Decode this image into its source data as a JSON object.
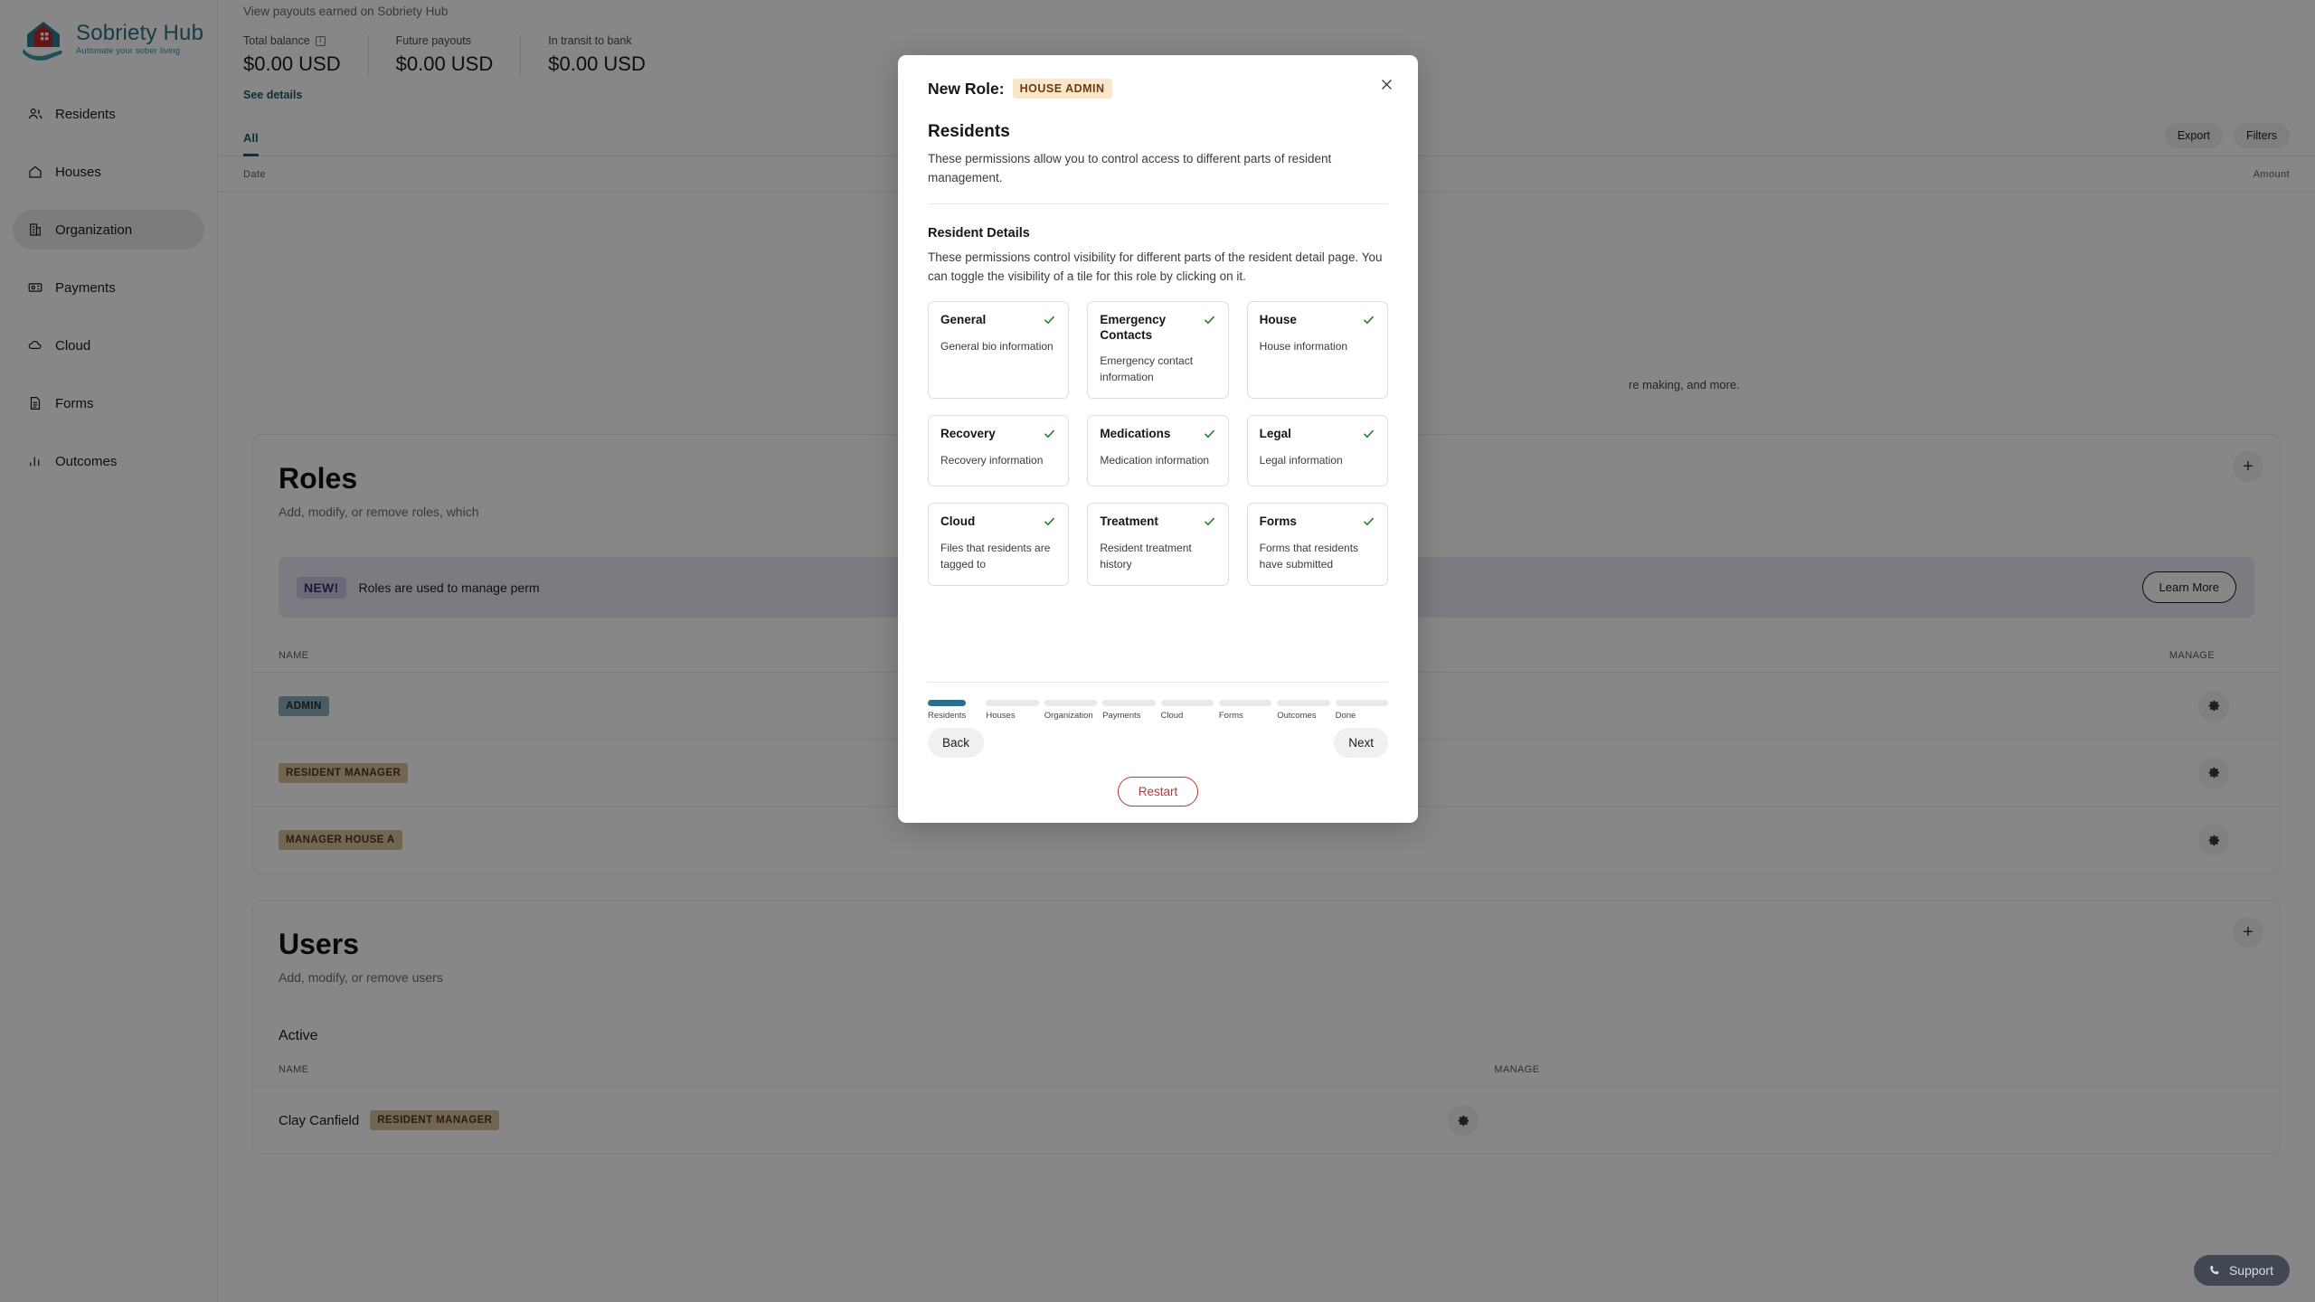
{
  "brand": {
    "name": "Sobriety Hub",
    "tagline": "Automate your sober living"
  },
  "sidebar": {
    "items": [
      {
        "label": "Residents",
        "icon": "users-icon",
        "active": false
      },
      {
        "label": "Houses",
        "icon": "home-icon",
        "active": false
      },
      {
        "label": "Organization",
        "icon": "building-icon",
        "active": true
      },
      {
        "label": "Payments",
        "icon": "card-icon",
        "active": false
      },
      {
        "label": "Cloud",
        "icon": "cloud-icon",
        "active": false
      },
      {
        "label": "Forms",
        "icon": "document-icon",
        "active": false
      },
      {
        "label": "Outcomes",
        "icon": "bar-chart-icon",
        "active": false
      }
    ]
  },
  "payouts": {
    "subtitle": "View payouts earned on Sobriety Hub",
    "stats": [
      {
        "label": "Total balance",
        "value": "$0.00 USD",
        "has_info_icon": true
      },
      {
        "label": "Future payouts",
        "value": "$0.00 USD",
        "has_info_icon": false
      },
      {
        "label": "In transit to bank",
        "value": "$0.00 USD",
        "has_info_icon": false
      }
    ],
    "see_details": "See details",
    "tab": "All",
    "export_label": "Export",
    "filters_label": "Filters",
    "col_date": "Date",
    "col_amount": "Amount",
    "empty_note": "re making, and more."
  },
  "roles_section": {
    "title": "Roles",
    "subtitle": "Add, modify, or remove roles, which",
    "add_label": "+",
    "banner": {
      "chip": "NEW!",
      "text": "Roles are used to manage perm",
      "button": "Learn More"
    },
    "columns": {
      "name": "NAME",
      "manage": "MANAGE"
    },
    "rows": [
      {
        "name": "ADMIN",
        "bg": "#8fb0bd",
        "fg": "#1d2f36"
      },
      {
        "name": "RESIDENT MANAGER",
        "bg": "#d7bf9c",
        "fg": "#4a3a22"
      },
      {
        "name": "MANAGER HOUSE A",
        "bg": "#d7bf9c",
        "fg": "#4a3a22"
      }
    ]
  },
  "users_section": {
    "title": "Users",
    "subtitle": "Add, modify, or remove users",
    "add_label": "+",
    "active_label": "Active",
    "columns": {
      "name": "NAME",
      "manage": "MANAGE"
    },
    "rows": [
      {
        "name": "Clay Canfield",
        "role": "RESIDENT MANAGER",
        "bg": "#d7bf9c",
        "fg": "#4a3a22"
      }
    ]
  },
  "support": {
    "label": "Support",
    "icon": "phone-icon"
  },
  "modal": {
    "role_label": "New Role:",
    "role_badge": "HOUSE ADMIN",
    "close_icon": "close-icon",
    "section_title": "Residents",
    "section_desc": "These permissions allow you to control access to different parts of resident management.",
    "sub_title": "Resident Details",
    "sub_desc": "These permissions control visibility for different parts of the resident detail page. You can toggle the visibility of a tile for this role by clicking on it.",
    "tiles": [
      {
        "name": "General",
        "desc": "General bio information",
        "enabled": true
      },
      {
        "name": "Emergency Contacts",
        "desc": "Emergency contact information",
        "enabled": true
      },
      {
        "name": "House",
        "desc": "House information",
        "enabled": true
      },
      {
        "name": "Recovery",
        "desc": "Recovery information",
        "enabled": true
      },
      {
        "name": "Medications",
        "desc": "Medication information",
        "enabled": true
      },
      {
        "name": "Legal",
        "desc": "Legal information",
        "enabled": true
      },
      {
        "name": "Cloud",
        "desc": "Files that residents are tagged to",
        "enabled": true
      },
      {
        "name": "Treatment",
        "desc": "Resident treatment history",
        "enabled": true
      },
      {
        "name": "Forms",
        "desc": "Forms that residents have submitted",
        "enabled": true
      }
    ],
    "steps": [
      {
        "label": "Residents",
        "state": "current"
      },
      {
        "label": "Houses",
        "state": "upcoming"
      },
      {
        "label": "Organization",
        "state": "upcoming"
      },
      {
        "label": "Payments",
        "state": "upcoming"
      },
      {
        "label": "Cloud",
        "state": "upcoming"
      },
      {
        "label": "Forms",
        "state": "upcoming"
      },
      {
        "label": "Outcomes",
        "state": "upcoming"
      },
      {
        "label": "Done",
        "state": "upcoming"
      }
    ],
    "back_label": "Back",
    "next_label": "Next",
    "restart_label": "Restart",
    "accent_color": "#2b6e8a",
    "restart_color": "#b23b37",
    "check_color": "#1f7a2e"
  }
}
